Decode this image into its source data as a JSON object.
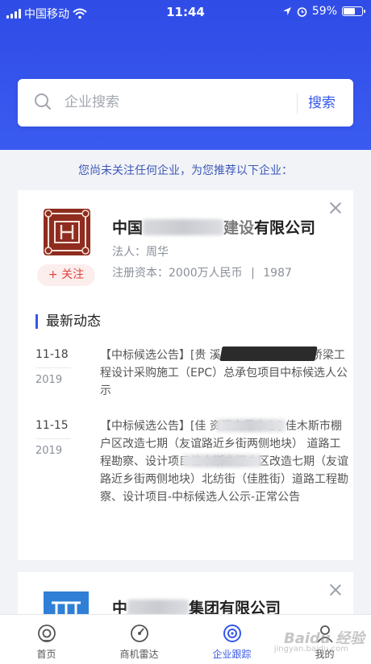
{
  "status_bar": {
    "carrier": "中国移动",
    "time": "11:44",
    "battery": "59%"
  },
  "search": {
    "placeholder": "企业搜索",
    "button_label": "搜索"
  },
  "recommend_text": "您尚未关注任何企业，为您推荐以下企业：",
  "card1": {
    "name_prefix": "中国",
    "name_mid": "建设",
    "name_suffix": "有限公司",
    "legal_rep": "法人：周华",
    "reg_capital": "注册资本：2000万人民币",
    "divider": "|",
    "year": "1987",
    "follow_label": "+ 关注",
    "news_heading": "最新动态",
    "news": [
      {
        "date": "11-18",
        "year": "2019",
        "text": "【中标候选公告】[贵                         溪市跨沪昆高速公路桥梁工程设计采购施工（EPC）总承包项目中标候选人公示"
      },
      {
        "date": "11-15",
        "year": "2019",
        "text": "【中标候选公告】[佳                    资源交易中心] 佳木斯市棚户区改造七期（友谊路近乡街两侧地块）                道路工程勘察、设计项目佳木斯市棚户区改造七期（友谊路近乡街两侧地块）北纺街（佳胜街）道路工程勘察、设计项目-中标候选人公示-正常公告"
      }
    ]
  },
  "card2": {
    "name_prefix": "中",
    "name_suffix": "集团有限公司"
  },
  "tabs": [
    {
      "label": "首页"
    },
    {
      "label": "商机雷达"
    },
    {
      "label": "企业跟踪"
    },
    {
      "label": "我的"
    }
  ],
  "watermark": {
    "main": "Baidu 经验",
    "sub": "jingyan.baidu.com"
  },
  "colors": {
    "brand": "#3558e8",
    "hero": "#3a5bf0",
    "follow": "#e0443c"
  }
}
